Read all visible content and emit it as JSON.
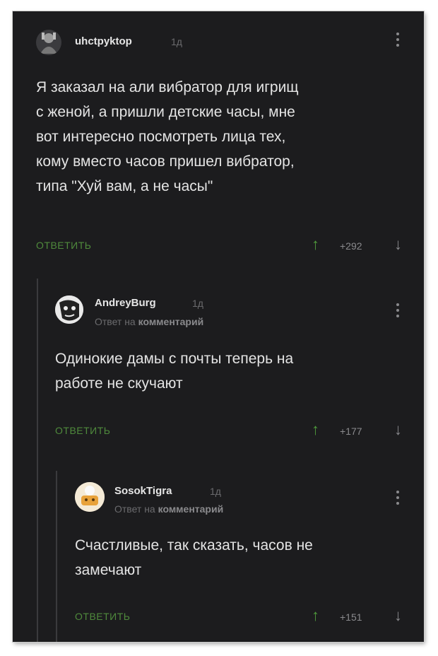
{
  "comments": [
    {
      "username": "uhctpyktop",
      "time": "1д",
      "reply_prefix": "",
      "reply_target": "",
      "text_lines": [
        "Я заказал на али вибратор для игрищ",
        "с женой, а пришли детские часы, мне",
        "вот интересно посмотреть лица тех,",
        "кому вместо часов пришел вибратор,",
        "типа \"Хуй вам, а не часы\""
      ],
      "reply_label": "ОТВЕТИТЬ",
      "rating": "+292"
    },
    {
      "username": "AndreyBurg",
      "time": "1д",
      "reply_prefix": "Ответ на",
      "reply_target": "комментарий",
      "text_lines": [
        "Одинокие дамы с почты теперь на",
        "работе не скучают"
      ],
      "reply_label": "ОТВЕТИТЬ",
      "rating": "+177"
    },
    {
      "username": "SosokTigra",
      "time": "1д",
      "reply_prefix": "Ответ на",
      "reply_target": "комментарий",
      "text_lines": [
        "Счастливые, так сказать, часов не",
        "замечают"
      ],
      "reply_label": "ОТВЕТИТЬ",
      "rating": "+151"
    }
  ],
  "icons": {
    "upvote": "arrow-up-icon",
    "downvote": "arrow-down-icon",
    "menu": "more-vertical-icon"
  },
  "colors": {
    "background": "#1c1c1e",
    "reply_green": "#4f8a3c",
    "upvote_green": "#4f9a3c",
    "text": "#e4e4e4",
    "muted": "#6b6b6e"
  }
}
